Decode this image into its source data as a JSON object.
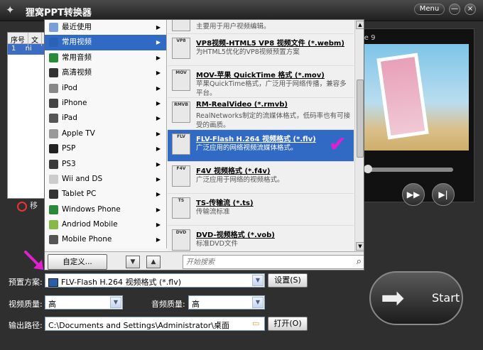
{
  "app": {
    "title": "狸窝PPT转换器",
    "menu_label": "Menu",
    "minimize_label": "—",
    "close_label": "×"
  },
  "file_list": {
    "col_index": "序号",
    "col_name": "文",
    "row_index": "1",
    "row_name": "ni",
    "remove_label": "移"
  },
  "preview": {
    "label": "le 9",
    "controls": [
      "▶▶",
      "▶|"
    ]
  },
  "categories": [
    {
      "label": "最近使用",
      "icon_color": "#7a9fd6"
    },
    {
      "label": "常用视频",
      "icon_color": "#2a62b6",
      "selected": true
    },
    {
      "label": "常用音频",
      "icon_color": "#2b8a3a"
    },
    {
      "label": "高清视频",
      "icon_color": "#333333"
    },
    {
      "label": "iPod",
      "icon_color": "#888888"
    },
    {
      "label": "iPhone",
      "icon_color": "#444444"
    },
    {
      "label": "iPad",
      "icon_color": "#555555"
    },
    {
      "label": "Apple TV",
      "icon_color": "#999999"
    },
    {
      "label": "PSP",
      "icon_color": "#222222"
    },
    {
      "label": "PS3",
      "icon_color": "#3a3a3a"
    },
    {
      "label": "Wii and DS",
      "icon_color": "#cccccc"
    },
    {
      "label": "Tablet PC",
      "icon_color": "#333333"
    },
    {
      "label": "Windows Phone",
      "icon_color": "#2b8a3a"
    },
    {
      "label": "Andriod Mobile",
      "icon_color": "#86b84a"
    },
    {
      "label": "Mobile Phone",
      "icon_color": "#555555"
    }
  ],
  "formats": [
    {
      "icon": "",
      "title": "",
      "desc": "主要用于用户视频编辑。"
    },
    {
      "icon": "VP8",
      "title": "VP8视频-HTML5 VP8 视频文件 (*.webm)",
      "desc": "为HTML5优化的VP8视频预置方案"
    },
    {
      "icon": "MOV",
      "title": "MOV-苹果 QuickTime 格式 (*.mov)",
      "desc": "苹果QuickTime格式，广泛用于网络传播，兼容多平台。"
    },
    {
      "icon": "RMVB",
      "title": "RM-RealVideo (*.rmvb)",
      "desc": "RealNetworks制定的流媒体格式，低码率也有可接受的画质。"
    },
    {
      "icon": "FLV",
      "title": "FLV-Flash H.264 视频格式 (*.flv)",
      "desc": "广泛应用的网络视频流媒体格式。",
      "selected": true
    },
    {
      "icon": "F4V",
      "title": "F4V 视频格式 (*.f4v)",
      "desc": "广泛应用于网络的视频格式。"
    },
    {
      "icon": "TS",
      "title": "TS-传输流 (*.ts)",
      "desc": "传输流标准"
    },
    {
      "icon": "DVD",
      "title": "DVD-视频格式 (*.vob)",
      "desc": "标准DVD文件"
    }
  ],
  "popup_footer": {
    "custom_label": "自定义...",
    "down_label": "▼",
    "up_label": "▲",
    "search_placeholder": "开始搜索"
  },
  "settings": {
    "preset_label": "预置方案:",
    "preset_value": "FLV-Flash H.264 视频格式 (*.flv)",
    "settings_button": "设置(S)",
    "video_quality_label": "视频质量:",
    "video_quality_value": "高",
    "audio_quality_label": "音频质量:",
    "audio_quality_value": "高",
    "output_path_label": "输出路径:",
    "output_path_value": "C:\\Documents and Settings\\Administrator\\桌面",
    "open_button": "打开(O)",
    "start_label": "Start"
  },
  "colors": {
    "selection_blue": "#316ac5",
    "checkmark_magenta": "#e020d0"
  }
}
